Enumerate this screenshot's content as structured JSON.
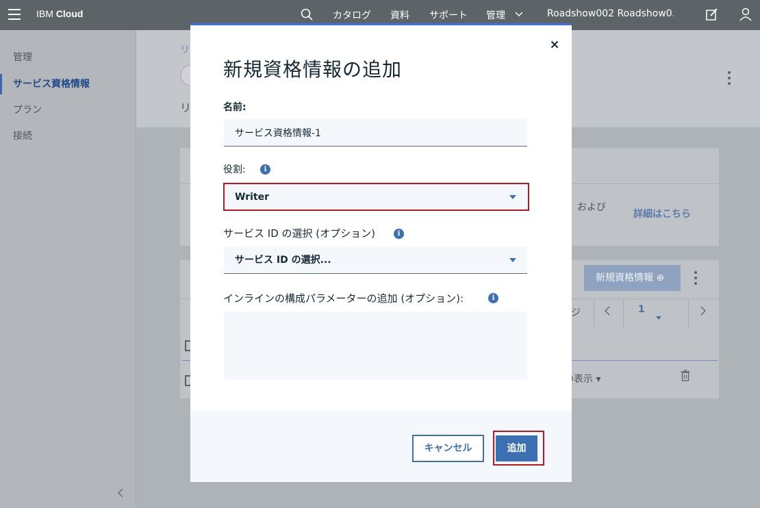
{
  "header": {
    "brand_prefix": "IBM",
    "brand_name": "Cloud",
    "nav": [
      "カタログ",
      "資料",
      "サポート",
      "管理"
    ],
    "account": "Roadshow002 Roadshow0..."
  },
  "sidebar": {
    "items": [
      {
        "label": "管理"
      },
      {
        "label": "サービス資格情報"
      },
      {
        "label": "プラン"
      },
      {
        "label": "接続"
      }
    ]
  },
  "background": {
    "breadcrumb_fragment": "リ",
    "header_fragment": "リ",
    "card_text": "および",
    "learn_more": "詳細はこちら",
    "new_credential_button": "新規資格情報",
    "pager_text": "ジ",
    "page_number": "1",
    "view_text": "の表示"
  },
  "modal": {
    "title": "新規資格情報の追加",
    "name_label": "名前:",
    "name_value": "サービス資格情報-1",
    "role_label": "役割:",
    "role_value": "Writer",
    "service_id_label": "サービス ID の選択 (オプション)",
    "service_id_value": "サービス ID の選択...",
    "inline_params_label": "インラインの構成パラメーターの追加 (オプション):",
    "inline_params_value": "",
    "cancel_label": "キャンセル",
    "add_label": "追加",
    "info_glyph": "i"
  },
  "colors": {
    "primary": "#3d70b2",
    "highlight": "#c0131b",
    "topbar": "#5d6468"
  }
}
